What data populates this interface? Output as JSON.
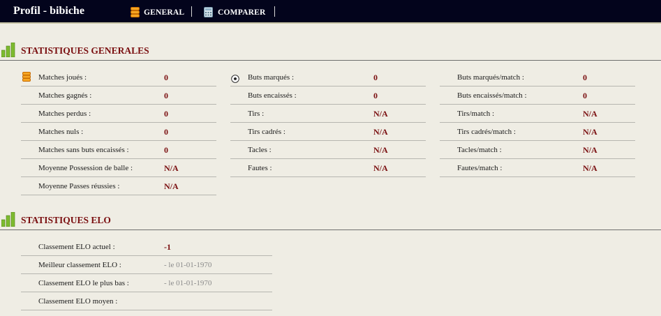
{
  "header": {
    "title": "Profil - bibiche",
    "nav": [
      {
        "label": "GENERAL",
        "icon": "database-icon"
      },
      {
        "label": "COMPARER",
        "icon": "calculator-icon"
      }
    ]
  },
  "colors": {
    "topbar": "#03041c",
    "background": "#efede4",
    "accent": "#7a0f10"
  },
  "general": {
    "title": "STATISTIQUES GENERALES",
    "col1": [
      {
        "label": "Matches joués :",
        "value": "0"
      },
      {
        "label": "Matches gagnés :",
        "value": "0"
      },
      {
        "label": "Matches perdus :",
        "value": "0"
      },
      {
        "label": "Matches nuls :",
        "value": "0"
      },
      {
        "label": "Matches sans buts encaissés :",
        "value": "0"
      },
      {
        "label": "Moyenne Possession de balle :",
        "value": "N/A"
      },
      {
        "label": "Moyenne Passes réussies :",
        "value": "N/A"
      }
    ],
    "col2": [
      {
        "label": "Buts marqués :",
        "value": "0"
      },
      {
        "label": "Buts encaissés :",
        "value": "0"
      },
      {
        "label": "Tirs :",
        "value": "N/A"
      },
      {
        "label": "Tirs cadrés :",
        "value": "N/A"
      },
      {
        "label": "Tacles :",
        "value": "N/A"
      },
      {
        "label": "Fautes :",
        "value": "N/A"
      }
    ],
    "col3": [
      {
        "label": "Buts marqués/match :",
        "value": "0"
      },
      {
        "label": "Buts encaissés/match :",
        "value": "0"
      },
      {
        "label": "Tirs/match :",
        "value": "N/A"
      },
      {
        "label": "Tirs cadrés/match :",
        "value": "N/A"
      },
      {
        "label": "Tacles/match :",
        "value": "N/A"
      },
      {
        "label": "Fautes/match :",
        "value": "N/A"
      }
    ]
  },
  "elo": {
    "title": "STATISTIQUES ELO",
    "rows": [
      {
        "label": "Classement ELO actuel :",
        "value": "-1"
      },
      {
        "label": "Meilleur classement ELO :",
        "value": "- le 01-01-1970"
      },
      {
        "label": "Classement ELO le plus bas :",
        "value": "- le 01-01-1970"
      },
      {
        "label": "Classement ELO moyen :",
        "value": ""
      }
    ]
  }
}
